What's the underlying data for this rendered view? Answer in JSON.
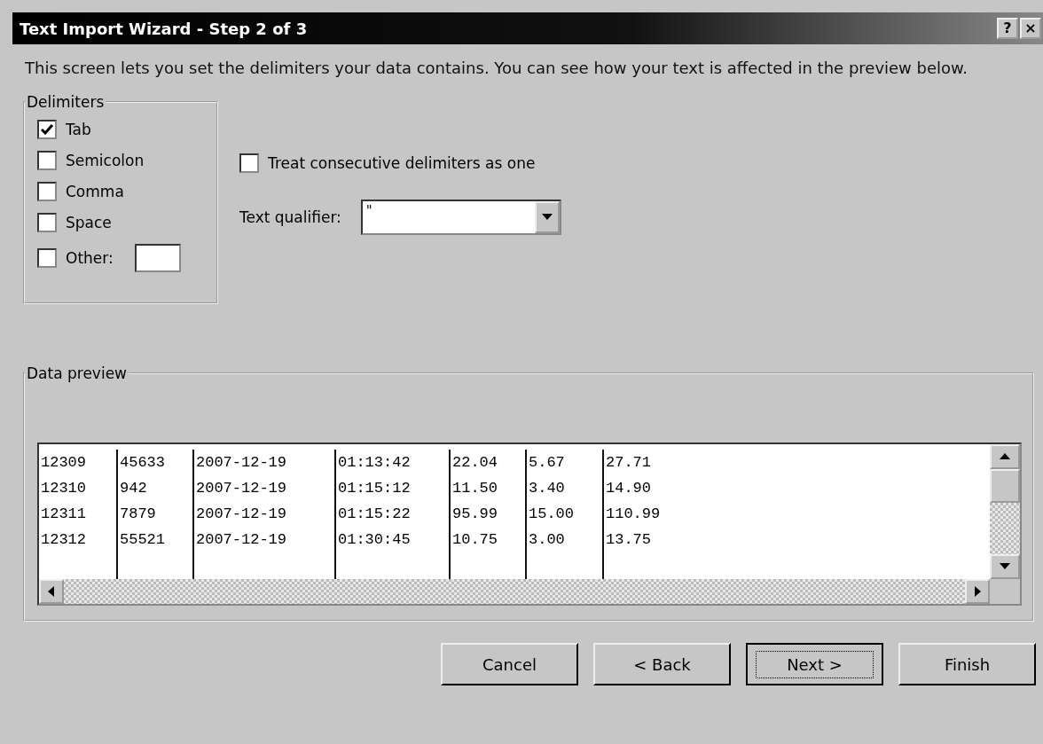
{
  "window": {
    "title": "Text Import Wizard - Step 2 of 3",
    "title_buttons": [
      "?",
      "×"
    ]
  },
  "description": "This screen lets you set the delimiters your data contains.  You can see how your text is affected in the preview below.",
  "delimiters": {
    "title": "Delimiters",
    "options": [
      {
        "label": "Tab",
        "checked": true,
        "kind": "plain"
      },
      {
        "label": "Semicolon",
        "checked": false,
        "kind": "plain"
      },
      {
        "label": "Comma",
        "checked": false,
        "kind": "plain"
      },
      {
        "label": "Space",
        "checked": false,
        "kind": "plain"
      },
      {
        "label": "Other:",
        "checked": false,
        "kind": "with_field"
      }
    ]
  },
  "consecutive": {
    "label": "Treat consecutive delimiters as one",
    "checked": false
  },
  "text_qualifier": {
    "label": "Text qualifier:",
    "value": "\""
  },
  "preview": {
    "title": "Data preview",
    "rows": [
      [
        "12309",
        "45633",
        "2007-12-19",
        "01:13:42",
        "22.04",
        "5.67",
        "27.71"
      ],
      [
        "12310",
        "942",
        "2007-12-19",
        "01:15:12",
        "11.50",
        "3.40",
        "14.90"
      ],
      [
        "12311",
        "7879",
        "2007-12-19",
        "01:15:22",
        "95.99",
        "15.00",
        "110.99"
      ],
      [
        "12312",
        "55521",
        "2007-12-19",
        "01:30:45",
        "10.75",
        "3.00",
        "13.75"
      ]
    ]
  },
  "buttons": [
    {
      "label": "Cancel",
      "focused": false
    },
    {
      "label": "< Back",
      "focused": false
    },
    {
      "label": "Next >",
      "focused": true
    },
    {
      "label": "Finish",
      "focused": false
    }
  ]
}
